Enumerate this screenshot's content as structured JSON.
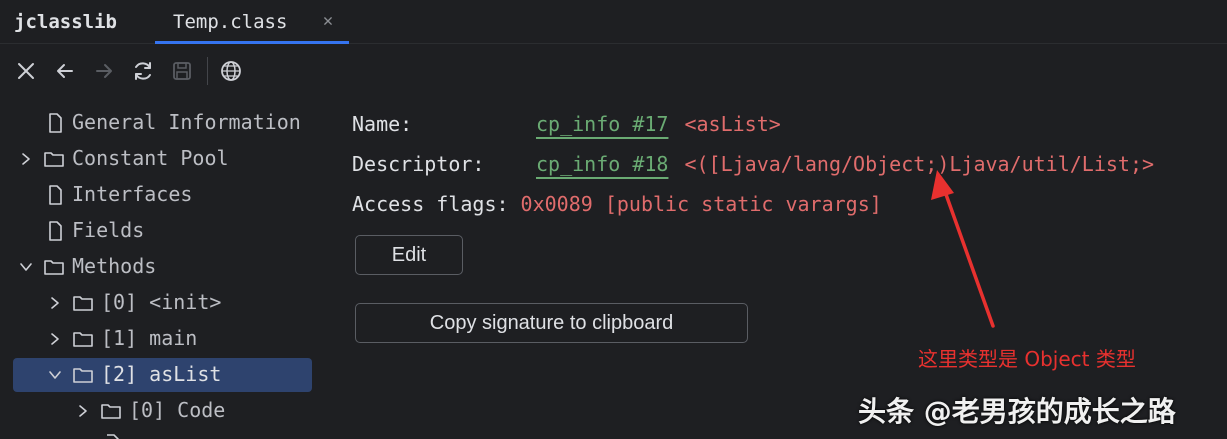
{
  "tabs": [
    {
      "label": "jclasslib"
    },
    {
      "label": "Temp.class",
      "active": true
    }
  ],
  "toolbar": {
    "icons": [
      "close-icon",
      "back-icon",
      "forward-icon",
      "refresh-icon",
      "save-icon",
      "globe-icon"
    ]
  },
  "tree": {
    "items": [
      {
        "label": "General Information",
        "icon": "file-icon",
        "expandable": false
      },
      {
        "label": "Constant Pool",
        "icon": "folder-icon",
        "expandable": true,
        "expanded": false
      },
      {
        "label": "Interfaces",
        "icon": "file-icon",
        "expandable": false
      },
      {
        "label": "Fields",
        "icon": "file-icon",
        "expandable": false
      },
      {
        "label": "Methods",
        "icon": "folder-icon",
        "expandable": true,
        "expanded": true
      },
      {
        "label": "[0] <init>",
        "icon": "folder-icon",
        "expandable": true,
        "expanded": false
      },
      {
        "label": "[1] main",
        "icon": "folder-icon",
        "expandable": true,
        "expanded": false
      },
      {
        "label": "[2] asList",
        "icon": "folder-icon",
        "expandable": true,
        "expanded": true,
        "selected": true
      },
      {
        "label": "[0] Code",
        "icon": "folder-icon",
        "expandable": true,
        "expanded": false
      }
    ]
  },
  "details": {
    "name_label": "Name:",
    "name_link": "cp_info #17",
    "name_value": "<asList>",
    "descriptor_label": "Descriptor:",
    "descriptor_link": "cp_info #18",
    "descriptor_value": "<([Ljava/lang/Object;)Ljava/util/List;>",
    "access_label": "Access flags:",
    "access_value": "0x0089 [public static varargs]",
    "edit_button": "Edit",
    "copy_button": "Copy signature to clipboard"
  },
  "annotation": {
    "text": "这里类型是 Object 类型",
    "color": "#e8312f"
  },
  "watermark": {
    "text": "头条 @老男孩的成长之路"
  },
  "colors": {
    "background": "#1e1f22",
    "link_green": "#6aab73",
    "value_red": "#e06c6c",
    "selection": "#2e436e",
    "tab_underline": "#3574f0"
  }
}
